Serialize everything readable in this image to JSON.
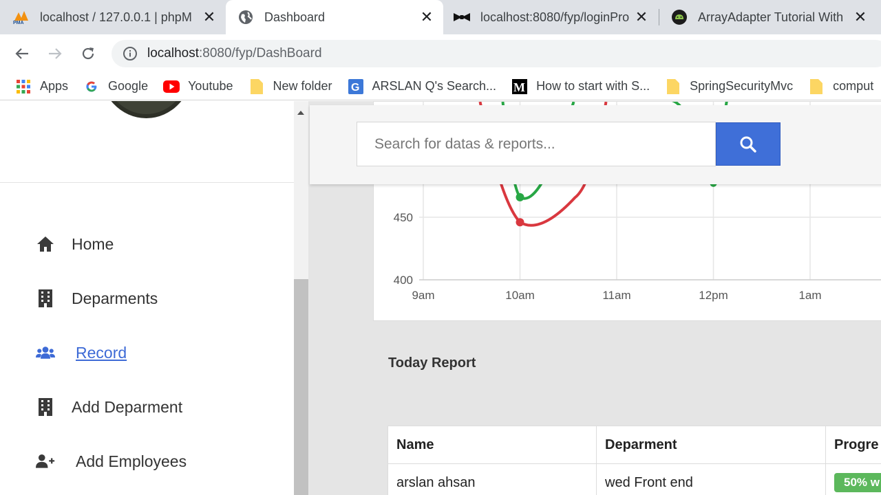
{
  "browser": {
    "tabs": [
      {
        "title": "localhost / 127.0.0.1 | phpMyAdmin",
        "icon": "phpmyadmin-icon"
      },
      {
        "title": "Dashboard",
        "icon": "globe-icon"
      },
      {
        "title": "localhost:8080/fyp/loginPro",
        "icon": "bowtie-icon"
      },
      {
        "title": "ArrayAdapter Tutorial With",
        "icon": "android-icon"
      }
    ],
    "url_host": "localhost",
    "url_path": ":8080/fyp/DashBoard",
    "bookmarks": [
      {
        "label": "Apps",
        "icon": "apps-grid-icon"
      },
      {
        "label": "Google",
        "icon": "google-icon"
      },
      {
        "label": "Youtube",
        "icon": "youtube-icon"
      },
      {
        "label": "New folder",
        "icon": "folder-icon"
      },
      {
        "label": "ARSLAN Q's Search...",
        "icon": "g-letter-icon"
      },
      {
        "label": "How to start with S...",
        "icon": "medium-icon"
      },
      {
        "label": "SpringSecurityMvc",
        "icon": "folder-icon"
      },
      {
        "label": "comput",
        "icon": "folder-icon"
      }
    ]
  },
  "sidebar": {
    "items": [
      {
        "label": "Home",
        "icon": "home-icon"
      },
      {
        "label": "Deparments",
        "icon": "building-icon"
      },
      {
        "label": "Record",
        "icon": "users-icon",
        "active": true
      },
      {
        "label": "Add Deparment",
        "icon": "building-icon"
      },
      {
        "label": "Add Employees",
        "icon": "user-plus-icon"
      }
    ]
  },
  "search": {
    "placeholder": "Search for datas & reports..."
  },
  "chart_data": {
    "type": "line",
    "x_ticks": [
      "9am",
      "10am",
      "11am",
      "12pm",
      "1am"
    ],
    "y_ticks": [
      400,
      450
    ],
    "series": [
      {
        "color": "#d9383f",
        "points": [
          {
            "x": "10am",
            "y": 446
          }
        ]
      },
      {
        "color": "#28a745",
        "points": [
          {
            "x": "10am",
            "y": 466
          },
          {
            "x": "12pm",
            "y": 477
          }
        ]
      }
    ]
  },
  "report": {
    "title": "Today Report",
    "columns": [
      "Name",
      "Deparment",
      "Progre"
    ],
    "rows": [
      {
        "name": "arslan ahsan",
        "department": "wed Front end",
        "progress": "50% w"
      }
    ]
  },
  "colors": {
    "accent": "#3f6fd8",
    "active_link": "#3d6ad6",
    "progress_badge": "#5cb85c"
  }
}
